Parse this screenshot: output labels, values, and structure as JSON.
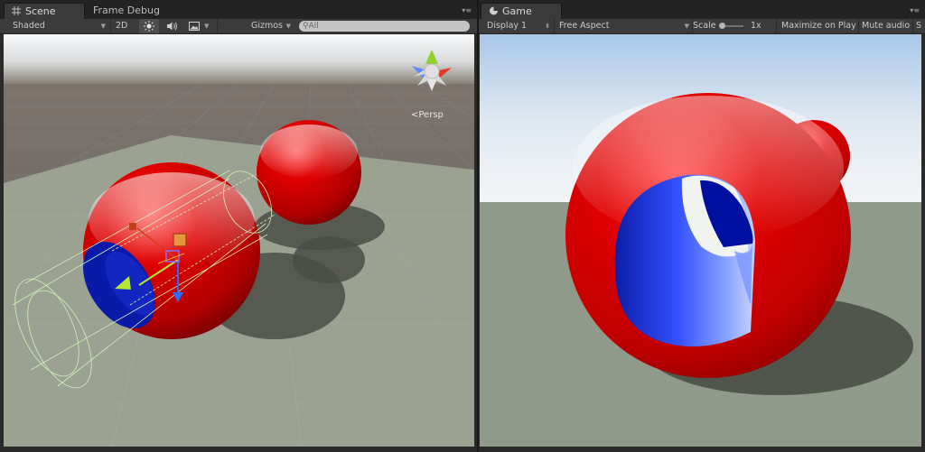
{
  "scene_panel": {
    "tabs": [
      {
        "label": "Scene",
        "active": true,
        "icon": "scene-grid-icon"
      },
      {
        "label": "Frame Debug",
        "active": false
      }
    ],
    "menu_icon": "panel-menu-icon",
    "toolbar": {
      "shading_mode": "Shaded",
      "mode_2d": "2D",
      "lighting_icon": "sun-icon",
      "audio_icon": "speaker-icon",
      "effects_icon": "image-icon",
      "gizmos_label": "Gizmos",
      "search_placeholder": "All",
      "search_icon": "search-icon"
    },
    "view": {
      "projection_label": "<Persp",
      "orientation_gizmo_icon": "scene-orientation-gizmo",
      "sky_color": "#f2f4f6",
      "horizon_color": "#8a8178",
      "ground_color": "#6e6864",
      "plane_color": "#9ba292",
      "sphere_color": "#d40000",
      "hole_color": "#0a1aa8"
    }
  },
  "game_panel": {
    "tabs": [
      {
        "label": "Game",
        "active": true,
        "icon": "game-controller-icon"
      }
    ],
    "menu_icon": "panel-menu-icon",
    "toolbar": {
      "display": "Display 1",
      "aspect": "Free Aspect",
      "scale_label": "Scale",
      "scale_value": "1x",
      "maximize_label": "Maximize on Play",
      "mute_label": "Mute audio",
      "stats_label": "S"
    },
    "view": {
      "sky_top_color": "#a9c8e8",
      "sky_bottom_color": "#f4f6f8",
      "plane_color": "#8f9a8a",
      "sphere_color": "#d80000",
      "hole_color": "#2233e0"
    }
  }
}
